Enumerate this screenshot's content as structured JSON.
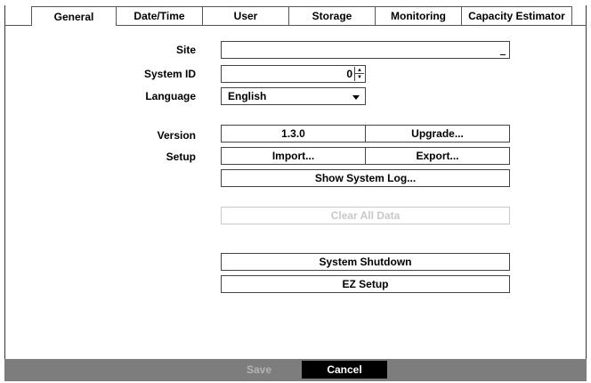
{
  "tabs": [
    {
      "label": "General",
      "active": true
    },
    {
      "label": "Date/Time",
      "active": false
    },
    {
      "label": "User",
      "active": false
    },
    {
      "label": "Storage",
      "active": false
    },
    {
      "label": "Monitoring",
      "active": false
    },
    {
      "label": "Capacity Estimator",
      "active": false
    }
  ],
  "form": {
    "site_label": "Site",
    "site_value": "",
    "system_id_label": "System ID",
    "system_id_value": "0",
    "language_label": "Language",
    "language_value": "English",
    "version_label": "Version",
    "version_value": "1.3.0",
    "upgrade_button": "Upgrade...",
    "setup_label": "Setup",
    "import_button": "Import...",
    "export_button": "Export...",
    "show_log_button": "Show System Log...",
    "clear_all_button": "Clear All Data",
    "shutdown_button": "System Shutdown",
    "ez_setup_button": "EZ Setup"
  },
  "footer": {
    "save": "Save",
    "cancel": "Cancel"
  },
  "icons": {
    "spin_up": "up-arrow-icon",
    "spin_down": "down-arrow-icon",
    "dropdown": "chevron-down-icon"
  },
  "colors": {
    "footer_bg": "#7d7d7d",
    "cancel_bg": "#000000",
    "disabled_text": "#c8c8c8"
  }
}
